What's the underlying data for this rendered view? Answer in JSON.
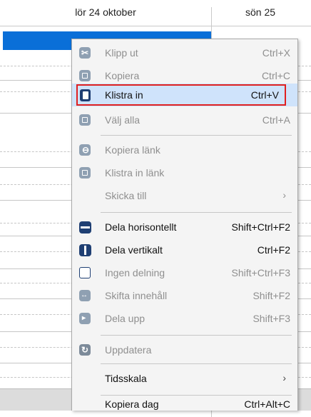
{
  "calendar": {
    "day1_label": "lör 24 oktober",
    "day2_label": "sön 25"
  },
  "menu": {
    "items": [
      {
        "label": "Klipp ut",
        "shortcut": "Ctrl+X",
        "icon": "scissors-icon",
        "enabled": false
      },
      {
        "label": "Kopiera",
        "shortcut": "Ctrl+C",
        "icon": "copy-icon",
        "enabled": false
      },
      {
        "label": "Klistra in",
        "shortcut": "Ctrl+V",
        "icon": "paste-icon",
        "enabled": true,
        "highlighted": true
      },
      {
        "label": "Välj alla",
        "shortcut": "Ctrl+A",
        "icon": "select-all-icon",
        "enabled": false
      },
      {
        "label": "Kopiera länk",
        "shortcut": "",
        "icon": "copy-link-icon",
        "enabled": false
      },
      {
        "label": "Klistra in länk",
        "shortcut": "",
        "icon": "paste-link-icon",
        "enabled": false
      },
      {
        "label": "Skicka till",
        "shortcut": "",
        "icon": "",
        "enabled": false,
        "submenu": true
      },
      {
        "label": "Dela horisontellt",
        "shortcut": "Shift+Ctrl+F2",
        "icon": "split-horizontal-icon",
        "enabled": true
      },
      {
        "label": "Dela vertikalt",
        "shortcut": "Ctrl+F2",
        "icon": "split-vertical-icon",
        "enabled": true
      },
      {
        "label": "Ingen delning",
        "shortcut": "Shift+Ctrl+F3",
        "icon": "no-split-icon",
        "enabled": false
      },
      {
        "label": "Skifta innehåll",
        "shortcut": "Shift+F2",
        "icon": "swap-content-icon",
        "enabled": false
      },
      {
        "label": "Dela upp",
        "shortcut": "Shift+F3",
        "icon": "split-up-icon",
        "enabled": false
      },
      {
        "label": "Uppdatera",
        "shortcut": "",
        "icon": "refresh-icon",
        "enabled": false
      },
      {
        "label": "Tidsskala",
        "shortcut": "",
        "icon": "",
        "enabled": true,
        "submenu": true
      },
      {
        "label": "Kopiera dag",
        "shortcut": "Ctrl+Alt+C",
        "icon": "",
        "enabled": true
      }
    ],
    "submenu_arrow": "›"
  },
  "colors": {
    "selection": "#0a6fd8",
    "highlight_box": "#e02020",
    "icon_blue": "#1f3f73"
  }
}
